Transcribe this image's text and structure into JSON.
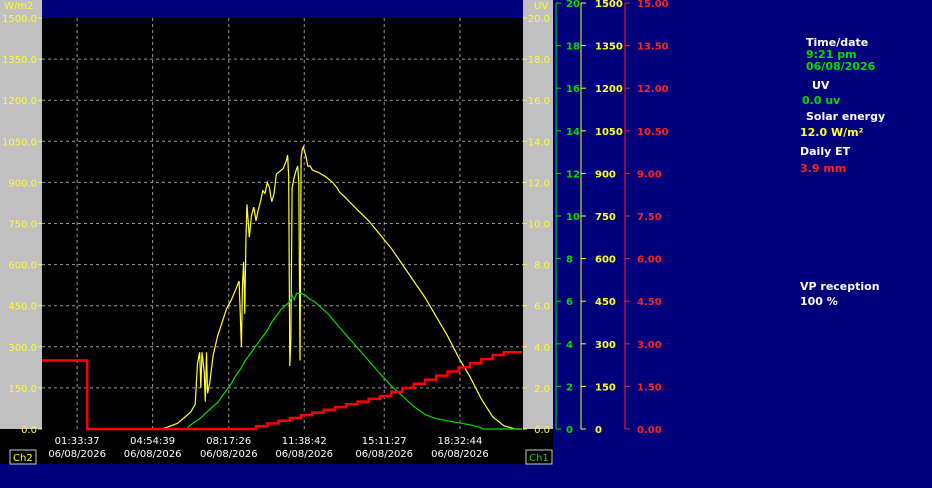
{
  "sidebar": {
    "time_label": "Time/date",
    "time_value": "9:21 pm",
    "date_value": "06/08/2026",
    "uv_label": "UV",
    "uv_value": "0.0 uv",
    "solar_label": "Solar energy",
    "solar_value": "12.0 W/m²",
    "et_label": "Daily ET",
    "et_value": "3.9 mm",
    "vp_label": "VP reception",
    "vp_value": "100 %"
  },
  "colors": {
    "background": "#00007a",
    "plot": "#000000",
    "solar": "#ffff33",
    "uv": "#00dd00",
    "et": "#ff0000",
    "panel": "#c0c0c0"
  },
  "chart_data": {
    "type": "line",
    "x_tick_labels": [
      {
        "time": "01:33:37",
        "date": "06/08/2026"
      },
      {
        "time": "04:54:39",
        "date": "06/08/2026"
      },
      {
        "time": "08:17:26",
        "date": "06/08/2026"
      },
      {
        "time": "11:38:42",
        "date": "06/08/2026"
      },
      {
        "time": "15:11:27",
        "date": "06/08/2026"
      },
      {
        "time": "18:32:44",
        "date": "06/08/2026"
      }
    ],
    "x_range": [
      "00:00",
      "21:21"
    ],
    "grid": true,
    "left_axis": {
      "unit": "W/m2",
      "ylim": [
        0,
        1500
      ],
      "ticks": [
        "0.0",
        "150.0",
        "300.0",
        "450.0",
        "600.0",
        "750.0",
        "900.0",
        "1050.0",
        "1200.0",
        "1350.0",
        "1500.0"
      ]
    },
    "uv_scale_axis": {
      "unit": "UV",
      "ylim": [
        0,
        20
      ],
      "ticks": [
        "0.0",
        "2.0",
        "4.0",
        "6.0",
        "8.0",
        "10.0",
        "12.0",
        "14.0",
        "16.0",
        "18.0",
        "20.0"
      ]
    },
    "right_axes": [
      {
        "color": "#00dd00",
        "ylim": [
          0,
          20
        ],
        "ticks": [
          "0",
          "2",
          "4",
          "6",
          "8",
          "10",
          "12",
          "14",
          "16",
          "18",
          "20"
        ]
      },
      {
        "color": "#ffff33",
        "ylim": [
          0,
          1500
        ],
        "ticks": [
          "0",
          "150",
          "300",
          "450",
          "600",
          "750",
          "900",
          "1050",
          "1200",
          "1350",
          "1500"
        ]
      },
      {
        "color": "#ff2222",
        "ylim": [
          0,
          15
        ],
        "ticks": [
          "0.00",
          "1.50",
          "3.00",
          "4.50",
          "6.00",
          "7.50",
          "9.00",
          "10.50",
          "12.00",
          "13.50",
          "15.00"
        ]
      }
    ],
    "channel_labels": {
      "left": "Ch2",
      "right": "Ch1"
    },
    "series": [
      {
        "color": "#ffff33",
        "axis": "solar",
        "points": [
          [
            5.3,
            0
          ],
          [
            5.6,
            8
          ],
          [
            6.0,
            20
          ],
          [
            6.3,
            40
          ],
          [
            6.6,
            62
          ],
          [
            6.8,
            90
          ],
          [
            6.9,
            240
          ],
          [
            7.0,
            280
          ],
          [
            7.05,
            150
          ],
          [
            7.1,
            280
          ],
          [
            7.2,
            210
          ],
          [
            7.25,
            100
          ],
          [
            7.3,
            280
          ],
          [
            7.35,
            130
          ],
          [
            7.45,
            170
          ],
          [
            7.6,
            270
          ],
          [
            7.8,
            340
          ],
          [
            8.0,
            390
          ],
          [
            8.2,
            440
          ],
          [
            8.4,
            470
          ],
          [
            8.6,
            510
          ],
          [
            8.75,
            540
          ],
          [
            8.85,
            300
          ],
          [
            8.9,
            530
          ],
          [
            8.95,
            610
          ],
          [
            9.0,
            420
          ],
          [
            9.05,
            690
          ],
          [
            9.1,
            820
          ],
          [
            9.2,
            700
          ],
          [
            9.3,
            780
          ],
          [
            9.4,
            810
          ],
          [
            9.5,
            760
          ],
          [
            9.6,
            800
          ],
          [
            9.7,
            830
          ],
          [
            9.8,
            870
          ],
          [
            9.9,
            860
          ],
          [
            10.0,
            900
          ],
          [
            10.1,
            880
          ],
          [
            10.15,
            850
          ],
          [
            10.2,
            830
          ],
          [
            10.3,
            860
          ],
          [
            10.4,
            930
          ],
          [
            10.55,
            940
          ],
          [
            10.7,
            950
          ],
          [
            10.85,
            980
          ],
          [
            10.9,
            1000
          ],
          [
            10.95,
            920
          ],
          [
            11.0,
            230
          ],
          [
            11.05,
            330
          ],
          [
            11.1,
            880
          ],
          [
            11.2,
            920
          ],
          [
            11.3,
            950
          ],
          [
            11.35,
            960
          ],
          [
            11.4,
            900
          ],
          [
            11.45,
            250
          ],
          [
            11.5,
            990
          ],
          [
            11.55,
            1020
          ],
          [
            11.6,
            1030
          ],
          [
            11.7,
            1000
          ],
          [
            11.8,
            960
          ],
          [
            11.9,
            960
          ],
          [
            12.0,
            945
          ],
          [
            12.3,
            935
          ],
          [
            12.6,
            920
          ],
          [
            12.9,
            900
          ],
          [
            13.1,
            880
          ],
          [
            13.2,
            865
          ],
          [
            13.4,
            850
          ],
          [
            14.0,
            800
          ],
          [
            14.5,
            760
          ],
          [
            15.0,
            710
          ],
          [
            15.5,
            660
          ],
          [
            16.0,
            600
          ],
          [
            16.5,
            540
          ],
          [
            17.0,
            480
          ],
          [
            17.5,
            410
          ],
          [
            18.0,
            340
          ],
          [
            18.5,
            260
          ],
          [
            19.0,
            190
          ],
          [
            19.5,
            110
          ],
          [
            20.0,
            45
          ],
          [
            20.5,
            12
          ],
          [
            21.0,
            0
          ],
          [
            21.3,
            0
          ]
        ]
      },
      {
        "color": "#00dd00",
        "axis": "uv",
        "points": [
          [
            5.3,
            0
          ],
          [
            6.4,
            0
          ],
          [
            6.6,
            0.2
          ],
          [
            7.0,
            0.5
          ],
          [
            7.4,
            0.9
          ],
          [
            7.8,
            1.3
          ],
          [
            8.2,
            1.9
          ],
          [
            8.4,
            2.2
          ],
          [
            8.6,
            2.6
          ],
          [
            8.8,
            2.9
          ],
          [
            9.0,
            3.3
          ],
          [
            9.2,
            3.6
          ],
          [
            9.4,
            3.9
          ],
          [
            9.6,
            4.2
          ],
          [
            9.8,
            4.5
          ],
          [
            10.0,
            4.8
          ],
          [
            10.2,
            5.2
          ],
          [
            10.4,
            5.5
          ],
          [
            10.6,
            5.8
          ],
          [
            10.8,
            6.0
          ],
          [
            11.0,
            6.2
          ],
          [
            11.1,
            6.5
          ],
          [
            11.2,
            6.3
          ],
          [
            11.3,
            6.6
          ],
          [
            11.5,
            6.6
          ],
          [
            11.7,
            6.5
          ],
          [
            11.9,
            6.3
          ],
          [
            12.1,
            6.2
          ],
          [
            12.4,
            5.9
          ],
          [
            12.7,
            5.6
          ],
          [
            13.0,
            5.2
          ],
          [
            13.4,
            4.7
          ],
          [
            13.8,
            4.2
          ],
          [
            14.2,
            3.7
          ],
          [
            14.6,
            3.2
          ],
          [
            15.0,
            2.7
          ],
          [
            15.5,
            2.1
          ],
          [
            16.0,
            1.6
          ],
          [
            16.5,
            1.1
          ],
          [
            17.0,
            0.7
          ],
          [
            17.5,
            0.5
          ],
          [
            18.0,
            0.4
          ],
          [
            18.5,
            0.3
          ],
          [
            19.0,
            0.2
          ],
          [
            19.4,
            0.1
          ],
          [
            19.6,
            0
          ],
          [
            21.3,
            0
          ]
        ]
      },
      {
        "color": "#ff0000",
        "axis": "et",
        "points": [
          [
            0,
            2.5
          ],
          [
            2.0,
            2.5
          ],
          [
            2.0,
            0
          ],
          [
            9.5,
            0
          ],
          [
            9.5,
            0.1
          ],
          [
            10.0,
            0.1
          ],
          [
            10.0,
            0.2
          ],
          [
            10.5,
            0.2
          ],
          [
            10.5,
            0.3
          ],
          [
            11.0,
            0.3
          ],
          [
            11.0,
            0.4
          ],
          [
            11.5,
            0.4
          ],
          [
            11.5,
            0.5
          ],
          [
            12.0,
            0.5
          ],
          [
            12.0,
            0.6
          ],
          [
            12.5,
            0.6
          ],
          [
            12.5,
            0.7
          ],
          [
            13.0,
            0.7
          ],
          [
            13.0,
            0.8
          ],
          [
            13.5,
            0.8
          ],
          [
            13.5,
            0.9
          ],
          [
            14.0,
            0.9
          ],
          [
            14.0,
            1.0
          ],
          [
            14.5,
            1.0
          ],
          [
            14.5,
            1.1
          ],
          [
            15.0,
            1.1
          ],
          [
            15.0,
            1.2
          ],
          [
            15.5,
            1.2
          ],
          [
            15.5,
            1.35
          ],
          [
            16.0,
            1.35
          ],
          [
            16.0,
            1.5
          ],
          [
            16.5,
            1.5
          ],
          [
            16.5,
            1.65
          ],
          [
            17.0,
            1.65
          ],
          [
            17.0,
            1.8
          ],
          [
            17.5,
            1.8
          ],
          [
            17.5,
            1.95
          ],
          [
            18.0,
            1.95
          ],
          [
            18.0,
            2.1
          ],
          [
            18.5,
            2.1
          ],
          [
            18.5,
            2.25
          ],
          [
            19.0,
            2.25
          ],
          [
            19.0,
            2.4
          ],
          [
            19.5,
            2.4
          ],
          [
            19.5,
            2.55
          ],
          [
            20.0,
            2.55
          ],
          [
            20.0,
            2.7
          ],
          [
            20.5,
            2.7
          ],
          [
            20.5,
            2.8
          ],
          [
            21.3,
            2.8
          ]
        ]
      }
    ]
  }
}
